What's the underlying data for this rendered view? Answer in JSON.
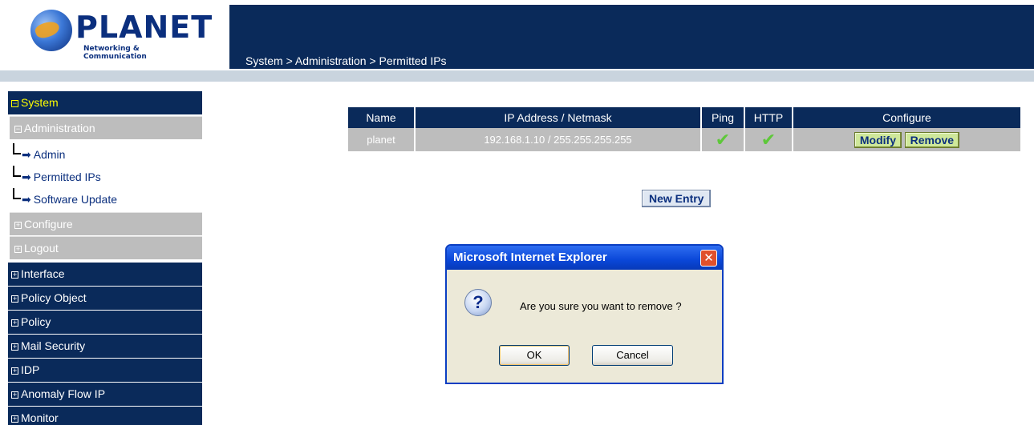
{
  "brand": {
    "name": "PLANET",
    "tagline": "Networking & Communication"
  },
  "breadcrumb": "System > Administration > Permitted IPs",
  "sidebar": {
    "system": "System",
    "administration": "Administration",
    "leaves": [
      "Admin",
      "Permitted IPs",
      "Software Update"
    ],
    "configure": "Configure",
    "logout": "Logout",
    "sections": [
      "Interface",
      "Policy Object",
      "Policy",
      "Mail Security",
      "IDP",
      "Anomaly Flow IP",
      "Monitor"
    ]
  },
  "table": {
    "headers": [
      "Name",
      "IP Address / Netmask",
      "Ping",
      "HTTP",
      "Configure"
    ],
    "rows": [
      {
        "name": "planet",
        "ip": "192.168.1.10 / 255.255.255.255",
        "ping": "✔",
        "http": "✔"
      }
    ],
    "modify_label": "Modify",
    "remove_label": "Remove"
  },
  "new_entry_label": "New Entry",
  "dialog": {
    "title": "Microsoft Internet Explorer",
    "message": "Are you sure you want to remove ?",
    "ok": "OK",
    "cancel": "Cancel",
    "icon": "question-icon"
  },
  "colors": {
    "nav": "#0a2a5a",
    "sub": "#bdbdbd",
    "active": "#ffff00",
    "button": "#cfe89a"
  }
}
